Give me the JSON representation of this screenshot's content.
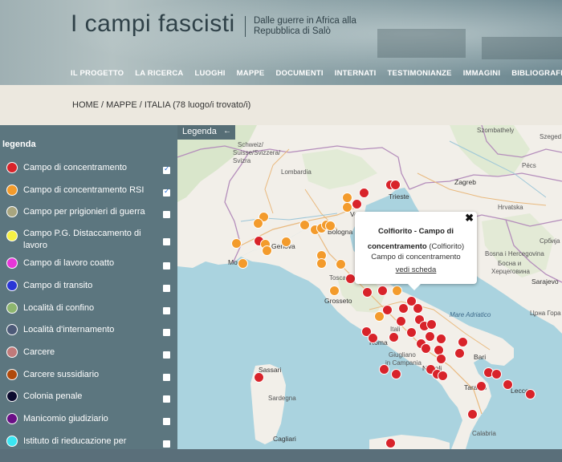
{
  "header": {
    "title": "I campi fascisti",
    "subtitle": "Dalle guerre in Africa alla Repubblica di Salò",
    "nav": [
      "IL PROGETTO",
      "LA RICERCA",
      "LUOGHI",
      "MAPPE",
      "DOCUMENTI",
      "INTERNATI",
      "TESTIMONIANZE",
      "IMMAGINI",
      "BIBLIOGRAFIA"
    ]
  },
  "breadcrumb": {
    "home": "HOME",
    "sep1": " / ",
    "maps": "MAPPE",
    "sep2": " / ",
    "current": "ITALIA (78 luogo/i trovato/i)"
  },
  "legend": {
    "tab_label": "Legenda",
    "tab_arrow": "←",
    "title": "legenda",
    "items": [
      {
        "label": "Campo di concentramento",
        "color": "#d8232a",
        "checked": true
      },
      {
        "label": "Campo di concentramento RSI",
        "color": "#f39b2c",
        "checked": true
      },
      {
        "label": "Campo per prigionieri di guerra",
        "color": "#a8a57f",
        "checked": false
      },
      {
        "label": "Campo P.G. Distaccamento di lavoro",
        "color": "#f7f045",
        "checked": false
      },
      {
        "label": "Campo di lavoro coatto",
        "color": "#e636d8",
        "checked": false
      },
      {
        "label": "Campo di transito",
        "color": "#2a36d6",
        "checked": false
      },
      {
        "label": "Località di confino",
        "color": "#8db56e",
        "checked": false
      },
      {
        "label": "Località d'internamento",
        "color": "#4d5a78",
        "checked": false
      },
      {
        "label": "Carcere",
        "color": "#c07a7a",
        "checked": false
      },
      {
        "label": "Carcere sussidiario",
        "color": "#b04a0c",
        "checked": false
      },
      {
        "label": "Colonia penale",
        "color": "#0b0b2e",
        "checked": false
      },
      {
        "label": "Manicomio giudiziario",
        "color": "#6a0f86",
        "checked": false
      },
      {
        "label": "Istituto di rieducazione per",
        "color": "#3ae6f2",
        "checked": false
      }
    ]
  },
  "popup": {
    "title": "Colfiorito - Campo di concentramento",
    "location": "(Colfiorito)",
    "type": "Campo di concentramento",
    "link": "vedi scheda",
    "close": "✖"
  },
  "map_labels": {
    "schweiz": "Schweiz/",
    "suisse": "Suisse/Svizzera/",
    "svizra": "Svizra",
    "lombardia": "Lombardia",
    "genova": "Genova",
    "monaco": "Mon",
    "bologna": "Bologna",
    "venezia": "Venezia",
    "trieste": "Trieste",
    "zagreb": "Zagreb",
    "hrvatska": "Hrvatska",
    "bosnia": "Bosna i Hercegovina",
    "bosnia_cyr": "Босна и",
    "bosnia_cyr2": "Херцеговина",
    "sarajevo": "Sarajevo",
    "crna_gora": "Црна Гора",
    "toscana": "Toscan",
    "grosseto": "Grosseto",
    "italia": "Itali",
    "roma": "Roma",
    "napoli": "Napoli",
    "giugliano": "Giugliano",
    "in_campania": "in Campania",
    "sassari": "Sassari",
    "sardegna": "Sardegna",
    "cagliari": "Cagliari",
    "bari": "Bari",
    "taranto": "Taranto",
    "lecce": "Lecce",
    "calabria": "Calabria",
    "szombathely": "Szombathely",
    "szeged": "Szeged",
    "pecs": "Pécs",
    "srbija": "Србија",
    "adriatico": "Mare Adriatico"
  }
}
